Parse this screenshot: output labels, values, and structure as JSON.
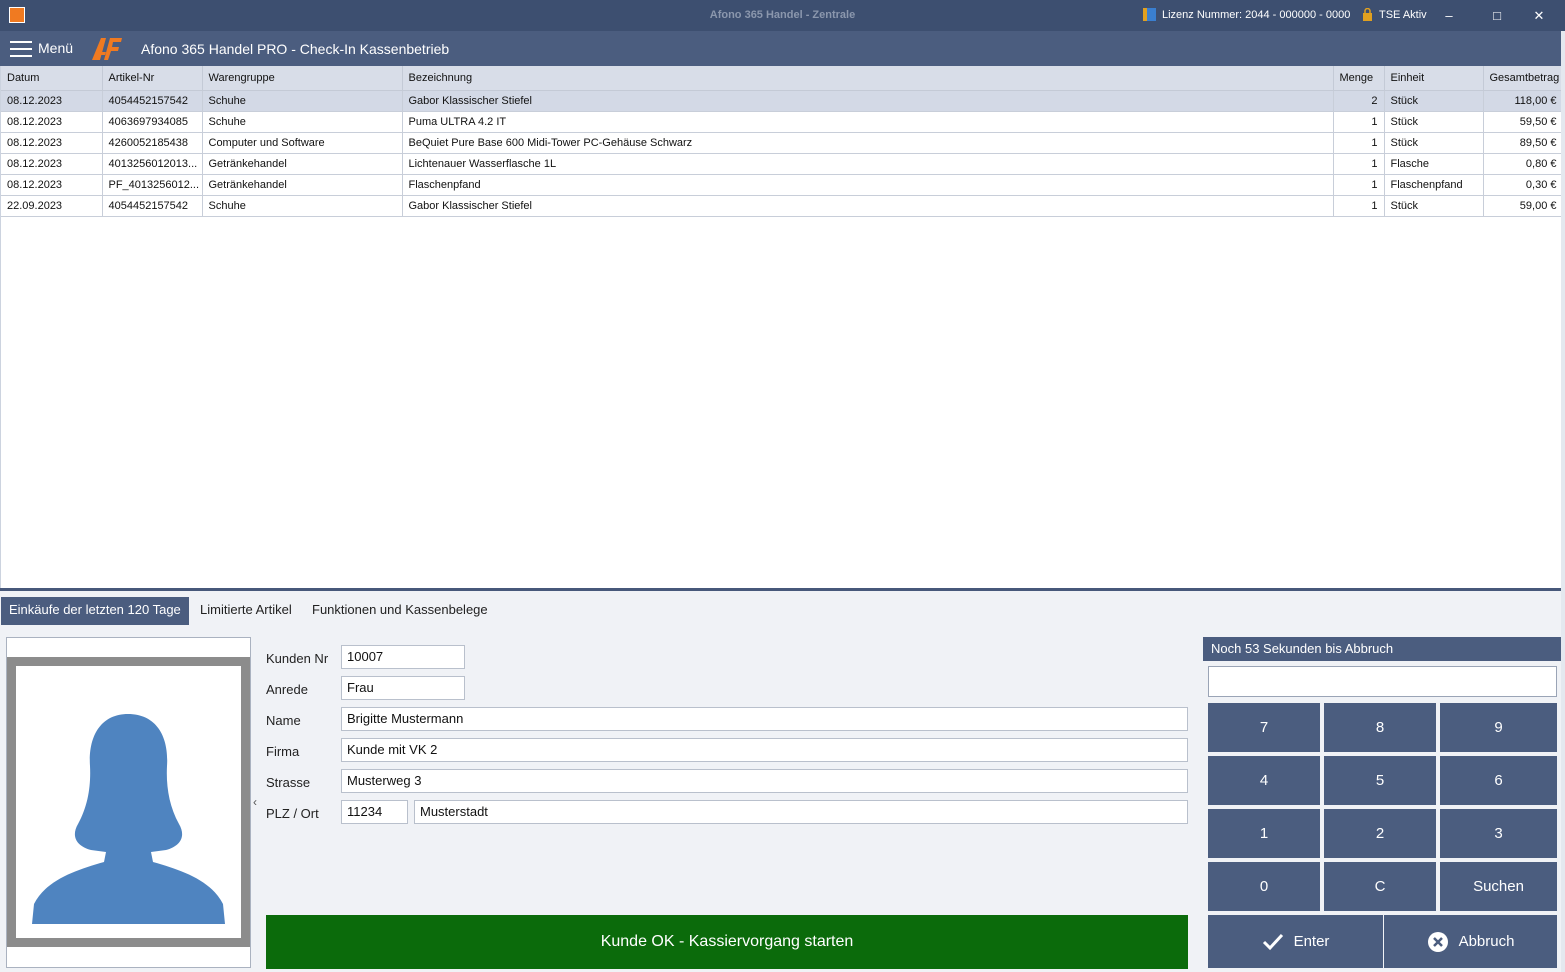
{
  "window": {
    "title": "Afono 365 Handel - Zentrale",
    "license": "Lizenz Nummer: 2044 - 000000 - 0000",
    "tse": "TSE Aktiv",
    "minimize": "–",
    "maximize": "□",
    "close": "✕"
  },
  "header": {
    "menu_label": "Menü",
    "app_title": "Afono 365 Handel PRO - Check-In Kassenbetrieb"
  },
  "grid": {
    "columns": [
      "Datum",
      "Artikel-Nr",
      "Warengruppe",
      "Bezeichnung",
      "Menge",
      "Einheit",
      "Gesamtbetrag"
    ],
    "rows": [
      [
        "08.12.2023",
        "4054452157542",
        "Schuhe",
        "Gabor Klassischer Stiefel",
        "2",
        "Stück",
        "118,00 €"
      ],
      [
        "08.12.2023",
        "4063697934085",
        "Schuhe",
        "Puma ULTRA 4.2 IT",
        "1",
        "Stück",
        "59,50 €"
      ],
      [
        "08.12.2023",
        "4260052185438",
        "Computer und Software",
        "BeQuiet Pure Base 600 Midi-Tower PC-Gehäuse Schwarz",
        "1",
        "Stück",
        "89,50 €"
      ],
      [
        "08.12.2023",
        "4013256012013...",
        "Getränkehandel",
        "Lichtenauer Wasserflasche 1L",
        "1",
        "Flasche",
        "0,80 €"
      ],
      [
        "08.12.2023",
        "PF_4013256012...",
        "Getränkehandel",
        "Flaschenpfand",
        "1",
        "Flaschenpfand",
        "0,30 €"
      ],
      [
        "22.09.2023",
        "4054452157542",
        "Schuhe",
        "Gabor Klassischer Stiefel",
        "1",
        "Stück",
        "59,00 €"
      ]
    ]
  },
  "tabs": [
    "Einkäufe der letzten 120 Tage",
    "Limitierte Artikel",
    "Funktionen und Kassenbelege"
  ],
  "customer": {
    "labels": {
      "kunden_nr": "Kunden Nr",
      "anrede": "Anrede",
      "name": "Name",
      "firma": "Firma",
      "strasse": "Strasse",
      "plz_ort": "PLZ / Ort"
    },
    "values": {
      "kunden_nr": "10007",
      "anrede": "Frau",
      "name": "Brigitte Mustermann",
      "firma": "Kunde mit VK 2",
      "strasse": "Musterweg 3",
      "plz": "11234",
      "ort": "Musterstadt"
    },
    "ok_button": "Kunde OK - Kassiervorgang starten",
    "collapse_arrow": "‹"
  },
  "keypad": {
    "countdown": "Noch 53 Sekunden bis Abbruch",
    "input_value": "",
    "keys": [
      "7",
      "8",
      "9",
      "4",
      "5",
      "6",
      "1",
      "2",
      "3",
      "0",
      "C",
      "Suchen"
    ],
    "enter": "Enter",
    "cancel": "Abbruch"
  },
  "colors": {
    "titlebar": "#3d4f70",
    "accent": "#4b5d7f",
    "ok_green": "#0b6b0b",
    "avatar_blue": "#4f84c0",
    "logo_orange": "#f07a21"
  }
}
